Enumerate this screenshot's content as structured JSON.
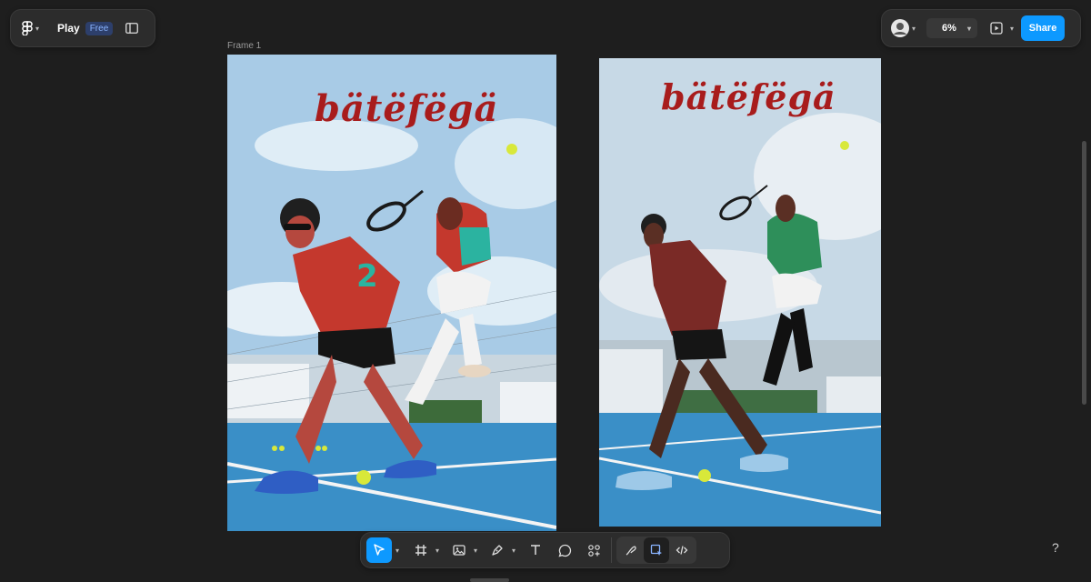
{
  "topbar": {
    "app_name": "Play",
    "plan_badge": "Free",
    "zoom": "6%",
    "share_label": "Share"
  },
  "canvas": {
    "frame_label": "Frame 1",
    "artwork_left": {
      "wordmark": "bätëfëgä",
      "jersey_number": "2"
    },
    "artwork_right": {
      "wordmark": "bätëfëgä"
    }
  },
  "toolbar": {
    "tools": [
      "move",
      "frame",
      "image",
      "pen",
      "text",
      "comment",
      "actions"
    ],
    "active_tool": "move"
  },
  "help_label": "?",
  "colors": {
    "accent": "#0d99ff",
    "canvas_bg": "#1e1e1e",
    "panel_bg": "#2c2c2c",
    "wordmark_red": "#a81c1c",
    "court_blue": "#3a8fc7"
  }
}
